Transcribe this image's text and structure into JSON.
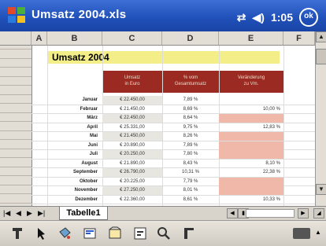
{
  "titlebar": {
    "title": "Umsatz 2004.xls",
    "time": "1:05",
    "ok_label": "ok"
  },
  "columns": [
    {
      "label": ""
    },
    {
      "label": "A"
    },
    {
      "label": "B"
    },
    {
      "label": "C"
    },
    {
      "label": "D"
    },
    {
      "label": "E"
    },
    {
      "label": "F"
    }
  ],
  "sheet": {
    "title": "Umsatz 2004",
    "headers": [
      {
        "line1": "Umsatz",
        "line2": "in Euro"
      },
      {
        "line1": "% vom",
        "line2": "Gesamtumsatz"
      },
      {
        "line1": "Veränderung",
        "line2": "zu Vm."
      }
    ],
    "rows": [
      {
        "month": "Januar",
        "value": "€ 22.450,00",
        "pct": "7,89 %",
        "change": "",
        "neg": false
      },
      {
        "month": "Februar",
        "value": "€ 21.450,00",
        "pct": "8,69 %",
        "change": "10,00 %",
        "neg": false
      },
      {
        "month": "März",
        "value": "€ 22.450,00",
        "pct": "8,64 %",
        "change": "",
        "neg": true
      },
      {
        "month": "April",
        "value": "€ 25.331,00",
        "pct": "9,75 %",
        "change": "12,83 %",
        "neg": false
      },
      {
        "month": "Mai",
        "value": "€ 21.450,00",
        "pct": "8,26 %",
        "change": "",
        "neg": true
      },
      {
        "month": "Juni",
        "value": "€ 20.890,00",
        "pct": "7,89 %",
        "change": "",
        "neg": true
      },
      {
        "month": "Juli",
        "value": "€ 20.250,00",
        "pct": "7,80 %",
        "change": "",
        "neg": true
      },
      {
        "month": "August",
        "value": "€ 21.890,00",
        "pct": "8,43 %",
        "change": "8,10 %",
        "neg": false
      },
      {
        "month": "September",
        "value": "€ 26.790,00",
        "pct": "10,31 %",
        "change": "22,38 %",
        "neg": false
      },
      {
        "month": "Oktober",
        "value": "€ 20.225,00",
        "pct": "7,79 %",
        "change": "",
        "neg": true
      },
      {
        "month": "November",
        "value": "€ 27.250,00",
        "pct": "8,01 %",
        "change": "",
        "neg": true
      },
      {
        "month": "Dezember",
        "value": "€ 22.360,00",
        "pct": "8,61 %",
        "change": "10,33 %",
        "neg": false
      }
    ]
  },
  "tabs": {
    "active": "Tabelle1"
  },
  "toolbar": {
    "icons": [
      "format-icon",
      "select-icon",
      "fill-icon",
      "format-cells-icon",
      "insert-function-icon",
      "autosum-icon",
      "zoom-icon",
      "freeze-panes-icon"
    ]
  },
  "colors": {
    "title_bg": "#f4ee88",
    "header_bg": "#9a2a22",
    "neg_bg": "#f0b8a8",
    "titlebar": "#1f4fb8"
  }
}
